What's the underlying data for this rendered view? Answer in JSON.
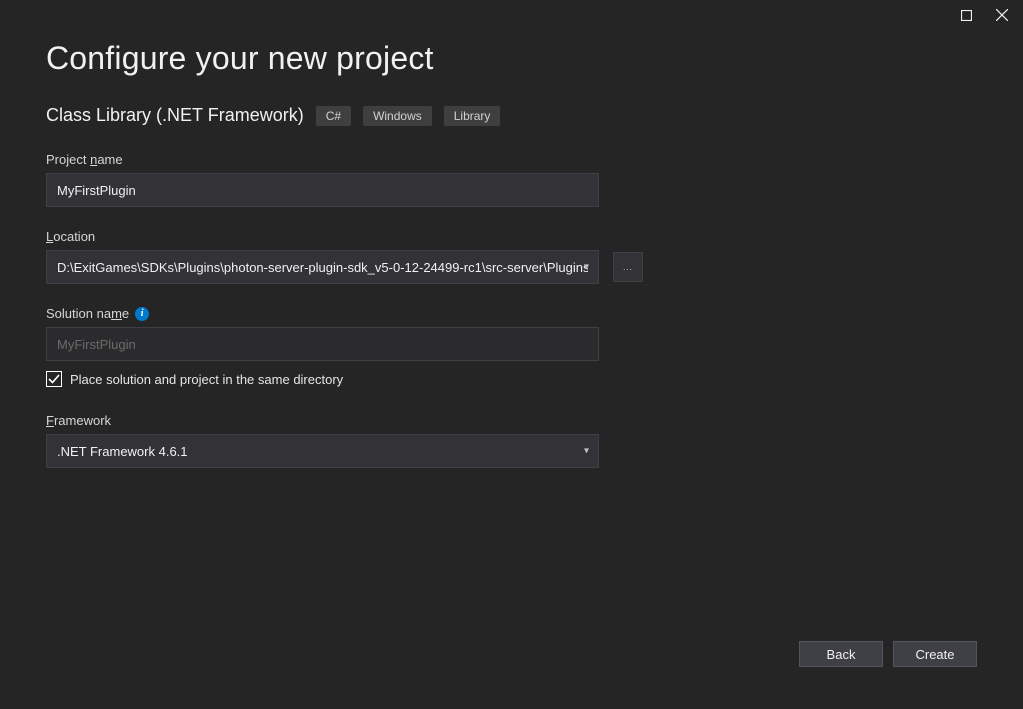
{
  "title": "Configure your new project",
  "project_type": "Class Library (.NET Framework)",
  "tags": [
    "C#",
    "Windows",
    "Library"
  ],
  "fields": {
    "project_name_label": "Project name",
    "project_name_value": "MyFirstPlugin",
    "location_label": "Location",
    "location_value": "D:\\ExitGames\\SDKs\\Plugins\\photon-server-plugin-sdk_v5-0-12-24499-rc1\\src-server\\Plugins\\",
    "solution_name_label": "Solution name",
    "solution_name_value": "MyFirstPlugin",
    "framework_label": "Framework",
    "framework_value": ".NET Framework 4.6.1",
    "same_dir_label": "Place solution and project in the same directory",
    "same_dir_checked": true,
    "browse_button": "..."
  },
  "footer": {
    "back_label": "Back",
    "create_label": "Create"
  }
}
